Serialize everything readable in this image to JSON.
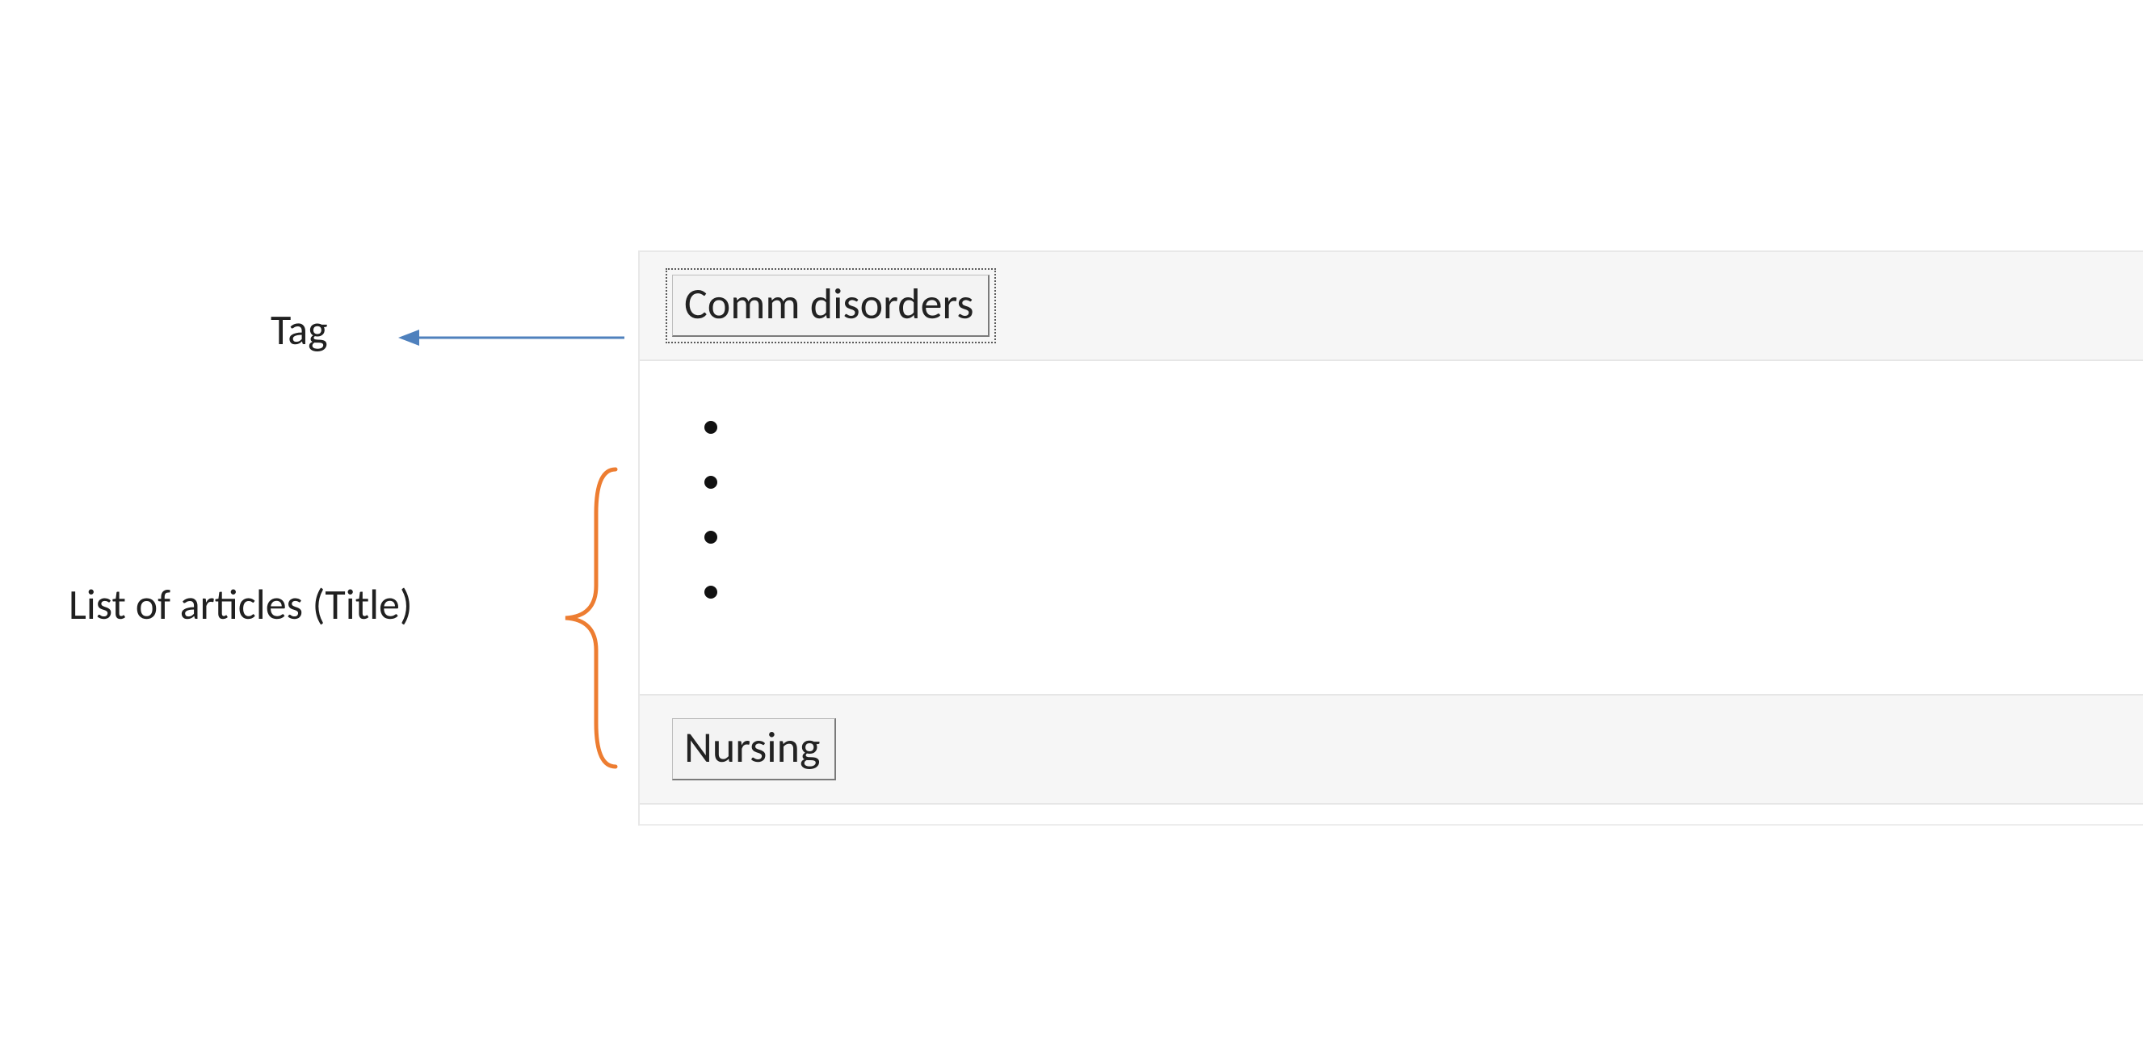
{
  "annotations": {
    "tag_label": "Tag",
    "list_label": "List of articles (Title)"
  },
  "colors": {
    "arrow": "#4F81BD",
    "brace": "#ED7D31",
    "panel_bg": "#f6f6f6"
  },
  "groups": [
    {
      "tag": "Comm disorders",
      "active": true,
      "articles": [
        "",
        "",
        "",
        ""
      ]
    },
    {
      "tag": "Nursing",
      "active": false,
      "articles": []
    }
  ]
}
